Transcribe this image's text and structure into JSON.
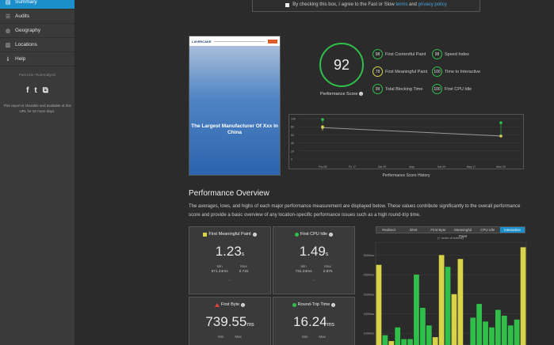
{
  "sidebar": {
    "items": [
      {
        "label": "Summary",
        "icon": "summary-icon",
        "glyph": "▤"
      },
      {
        "label": "Audits",
        "icon": "list-icon",
        "glyph": "☰"
      },
      {
        "label": "Geography",
        "icon": "globe-icon",
        "glyph": "◍"
      },
      {
        "label": "Locations",
        "icon": "server-icon",
        "glyph": "▥"
      },
      {
        "label": "Help",
        "icon": "help-icon",
        "glyph": "ℹ"
      }
    ],
    "small_text": "Fast Line: RunAnalysis",
    "social": [
      "f",
      "t",
      "⧉"
    ],
    "note": "This report is sharable and available at this URL for 92 more days."
  },
  "agreement": {
    "prefix": "By checking this box, I agree to the Fast or Slow ",
    "terms": "terms",
    "and": " and ",
    "privacy": "privacy policy"
  },
  "preview": {
    "logo": "LAYERCAKE",
    "headline": "The Largest Manufacturer Of Xxx In China"
  },
  "score": {
    "value": "92",
    "label": "Performance Score",
    "color": "#2fbf4a"
  },
  "metrics": [
    {
      "value": "98",
      "label": "First Contentful Paint",
      "warn": false
    },
    {
      "value": "78",
      "label": "First Meaningful Paint",
      "warn": true
    },
    {
      "value": "99",
      "label": "Total Blocking Time",
      "warn": false
    },
    {
      "value": "98",
      "label": "Speed Index",
      "warn": false
    },
    {
      "value": "100",
      "label": "Time to Interactive",
      "warn": false
    },
    {
      "value": "100",
      "label": "First CPU Idle",
      "warn": false
    }
  ],
  "chart_data": [
    {
      "type": "line",
      "title": "Performance Score History",
      "x": [
        "Thu 08",
        "Fri 17",
        "Sat 25",
        "May",
        "Sat 09",
        "May 17",
        "Mon 25"
      ],
      "ylim": [
        0,
        100
      ],
      "yticks": [
        "100",
        "80",
        "60",
        "40",
        "20",
        "0"
      ],
      "series": [
        {
          "values": [
            78,
            null,
            null,
            null,
            null,
            null,
            57
          ],
          "color": "#9a9a9a"
        },
        {
          "values": [
            98,
            null,
            null,
            null,
            null,
            null,
            90
          ],
          "color": "#2fbf4a"
        },
        {
          "values": [
            80,
            null,
            null,
            null,
            null,
            null,
            57
          ],
          "color": "#d9d34a"
        }
      ]
    },
    {
      "type": "bar",
      "title": "",
      "yticks": [
        "3000ms",
        "2500ms",
        "2000ms",
        "1500ms",
        "1000ms"
      ],
      "ylim": [
        700,
        3250
      ],
      "values": [
        2750,
        950,
        800,
        1150,
        850,
        850,
        2500,
        1650,
        1200,
        900,
        3000,
        2700,
        2000,
        2900,
        700,
        1400,
        1750,
        1300,
        1150,
        1600,
        1450,
        1200,
        1350,
        3200
      ],
      "colors": [
        "#d9d34a",
        "#2fbf4a",
        "#d9d34a",
        "#2fbf4a",
        "#2fbf4a",
        "#2fbf4a",
        "#2fbf4a",
        "#2fbf4a",
        "#2fbf4a",
        "#d9d34a",
        "#d9d34a",
        "#2fbf4a",
        "#d9d34a",
        "#d9d34a",
        "#2fbf4a",
        "#2fbf4a",
        "#2fbf4a",
        "#2fbf4a",
        "#2fbf4a",
        "#2fbf4a",
        "#2fbf4a",
        "#2fbf4a",
        "#2fbf4a",
        "#d9d34a"
      ]
    }
  ],
  "overview": {
    "title": "Performance Overview",
    "description": "The averages, lows, and highs of each major performance measurement are displayed below. These values contribute significantly to the overall performance score and provide a basic overview of any location-specific performance issues such as a high round-trip time."
  },
  "cards": [
    {
      "title": "First Meaningful Paint",
      "value": "1.23",
      "unit": "s",
      "min_label": "Min",
      "min": "971.24ms",
      "max_label": "Max",
      "max": "2.72s",
      "color": "#d9d34a",
      "shape": "square"
    },
    {
      "title": "First CPU Idle",
      "value": "1.49",
      "unit": "s",
      "min_label": "Min",
      "min": "731.24ms",
      "max_label": "Max",
      "max": "2.87s",
      "color": "#2fbf4a",
      "shape": "circle"
    },
    {
      "title": "First Byte",
      "value": "739.55",
      "unit": "ms",
      "min_label": "Min",
      "min": "",
      "max_label": "Max",
      "max": "",
      "color": "#e0453a",
      "shape": "triangle"
    },
    {
      "title": "Round-Trip Time",
      "value": "16.24",
      "unit": "ms",
      "min_label": "Min",
      "min": "",
      "max_label": "Max",
      "max": "",
      "color": "#2fbf4a",
      "shape": "circle"
    }
  ],
  "tabs": [
    "Redirect",
    "DNS",
    "First Byte",
    "Meaningful Paint",
    "CPU Idle",
    "Interactive"
  ],
  "active_tab": 5,
  "chart_caption": "(+ order of events)"
}
